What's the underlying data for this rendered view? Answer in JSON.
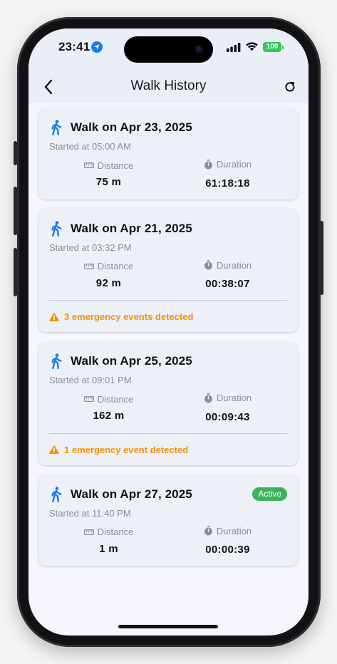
{
  "status_bar": {
    "time": "23:41",
    "battery": "100",
    "location_icon": "location-arrow-icon",
    "signal_icon": "cellular-signal-icon",
    "wifi_icon": "wifi-icon"
  },
  "header": {
    "title": "Walk History",
    "back_icon": "chevron-left-icon",
    "refresh_icon": "refresh-icon"
  },
  "labels": {
    "distance": "Distance",
    "duration": "Duration"
  },
  "walks": [
    {
      "title": "Walk on Apr 23, 2025",
      "started": "Started at 05:00 AM",
      "distance": "75 m",
      "duration": "61:18:18",
      "emergency": "",
      "badge": ""
    },
    {
      "title": "Walk on Apr 21, 2025",
      "started": "Started at 03:32 PM",
      "distance": "92 m",
      "duration": "00:38:07",
      "emergency": "3 emergency events detected",
      "badge": ""
    },
    {
      "title": "Walk on Apr 25, 2025",
      "started": "Started at 09:01 PM",
      "distance": "162 m",
      "duration": "00:09:43",
      "emergency": "1 emergency event detected",
      "badge": ""
    },
    {
      "title": "Walk on Apr 27, 2025",
      "started": "Started at 11:40 PM",
      "distance": "1 m",
      "duration": "00:00:39",
      "emergency": "",
      "badge": "Active"
    }
  ],
  "colors": {
    "accent": "#1a7cf3",
    "warning": "#f2910a",
    "active_badge": "#3cb35a"
  }
}
